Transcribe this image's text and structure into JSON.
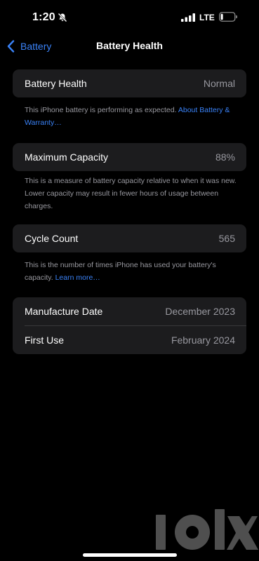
{
  "status_bar": {
    "time": "1:20",
    "network": "LTE",
    "icons": [
      "bell-slash-icon",
      "cellular-signal-icon",
      "battery-icon"
    ]
  },
  "nav": {
    "back_label": "Battery",
    "title": "Battery Health"
  },
  "health": {
    "label": "Battery Health",
    "value": "Normal",
    "note": "This iPhone battery is performing as expected.",
    "link": "About Battery & Warranty…"
  },
  "capacity": {
    "label": "Maximum Capacity",
    "value": "88%",
    "note": "This is a measure of battery capacity relative to when it was new. Lower capacity may result in fewer hours of usage between charges."
  },
  "cycles": {
    "label": "Cycle Count",
    "value": "565",
    "note": "This is the number of times iPhone has used your battery's capacity.",
    "link": "Learn more…"
  },
  "dates": {
    "manufacture_label": "Manufacture Date",
    "manufacture_value": "December 2023",
    "first_use_label": "First Use",
    "first_use_value": "February 2024"
  },
  "watermark": {
    "text": "olx"
  },
  "colors": {
    "background": "#000000",
    "card": "#1c1c1e",
    "accent": "#3a82f7",
    "secondary_text": "#98989f"
  }
}
